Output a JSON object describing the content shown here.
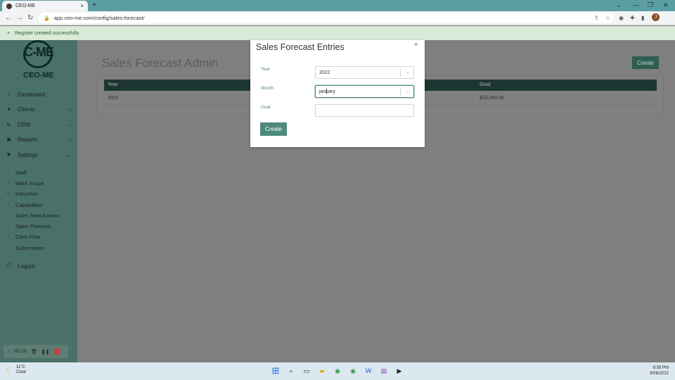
{
  "browser": {
    "tab_title": "CEO-ME",
    "tab_close": "×",
    "new_tab": "+",
    "url": "app.ceo-me.com/config/sales-forecast/"
  },
  "flash": {
    "icon": "×",
    "message": "Register created successfully."
  },
  "sidebar": {
    "logo_mark": "C-ME",
    "logo_text": "CEO-ME",
    "items": [
      {
        "label": "Dashboard",
        "icon": "home-icon",
        "glyph": "⌂"
      },
      {
        "label": "Clients",
        "icon": "users-icon",
        "glyph": "●",
        "chevron": "›"
      },
      {
        "label": "CRM",
        "icon": "chart-icon",
        "glyph": "⊵",
        "chevron": "›"
      },
      {
        "label": "Reports",
        "icon": "report-icon",
        "glyph": "▣",
        "chevron": "›"
      },
      {
        "label": "Settings",
        "icon": "wrench-icon",
        "glyph": "✖",
        "chevron": "⌄"
      }
    ],
    "sub_items": [
      "Staff",
      "Work Scope",
      "Industries",
      "Capabilities",
      "Sales Next Actions",
      "Sales Forecast",
      "Cash Flow",
      "Subscription"
    ],
    "logout": "Logout"
  },
  "page": {
    "title": "Sales Forecast Admin",
    "create_label": "Create",
    "table": {
      "headers": [
        "Year",
        "Goal"
      ],
      "rows": [
        [
          "2022",
          "$10,000.00"
        ]
      ]
    }
  },
  "modal": {
    "title": "Sales Forecast Entries",
    "close": "×",
    "year_label": "Year",
    "year_value": "2022",
    "month_label": "Month",
    "month_value": "january",
    "goal_label": "Goal",
    "goal_value": "",
    "submit_label": "Create"
  },
  "recorder": {
    "time": "00:18"
  },
  "taskbar": {
    "temperature": "11°C",
    "condition": "Clear",
    "time": "8:39 PM",
    "date": "8/06/2022"
  },
  "colors": {
    "accent": "#4e8a7c",
    "sidebar": "#4a7168",
    "table_header": "#1d3631"
  }
}
